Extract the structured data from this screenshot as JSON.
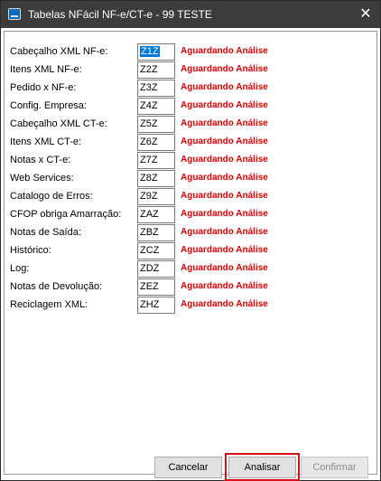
{
  "window": {
    "title": "Tabelas NFácil NF-e/CT-e - 99 TESTE",
    "close_glyph": "✕"
  },
  "rows": [
    {
      "label": "Cabeçalho XML NF-e:",
      "code": "Z1Z",
      "status": "Aguardando Análise",
      "selected": true
    },
    {
      "label": "Itens XML NF-e:",
      "code": "Z2Z",
      "status": "Aguardando Análise"
    },
    {
      "label": "Pedido x NF-e:",
      "code": "Z3Z",
      "status": "Aguardando Análise"
    },
    {
      "label": "Config. Empresa:",
      "code": "Z4Z",
      "status": "Aguardando Análise"
    },
    {
      "label": "Cabeçalho XML CT-e:",
      "code": "Z5Z",
      "status": "Aguardando Análise"
    },
    {
      "label": "Itens XML CT-e:",
      "code": "Z6Z",
      "status": "Aguardando Análise"
    },
    {
      "label": "Notas x CT-e:",
      "code": "Z7Z",
      "status": "Aguardando Análise"
    },
    {
      "label": "Web Services:",
      "code": "Z8Z",
      "status": "Aguardando Análise"
    },
    {
      "label": "Catalogo de Erros:",
      "code": "Z9Z",
      "status": "Aguardando Análise"
    },
    {
      "label": "CFOP obriga Amarração:",
      "code": "ZAZ",
      "status": "Aguardando Análise"
    },
    {
      "label": "Notas de Saída:",
      "code": "ZBZ",
      "status": "Aguardando Análise"
    },
    {
      "label": "Histórico:",
      "code": "ZCZ",
      "status": "Aguardando Análise"
    },
    {
      "label": "Log:",
      "code": "ZDZ",
      "status": "Aguardando Análise"
    },
    {
      "label": "Notas de Devolução:",
      "code": "ZEZ",
      "status": "Aguardando Análise"
    },
    {
      "label": "Reciclagem XML:",
      "code": "ZHZ",
      "status": "Aguardando Análise"
    }
  ],
  "buttons": {
    "cancel": "Cancelar",
    "analisar": "Analisar",
    "confirmar": "Confirmar"
  },
  "colors": {
    "titlebar": "#3c3c3c",
    "status": "#e00000",
    "selection": "#0078d7",
    "highlight": "#d9101a"
  }
}
